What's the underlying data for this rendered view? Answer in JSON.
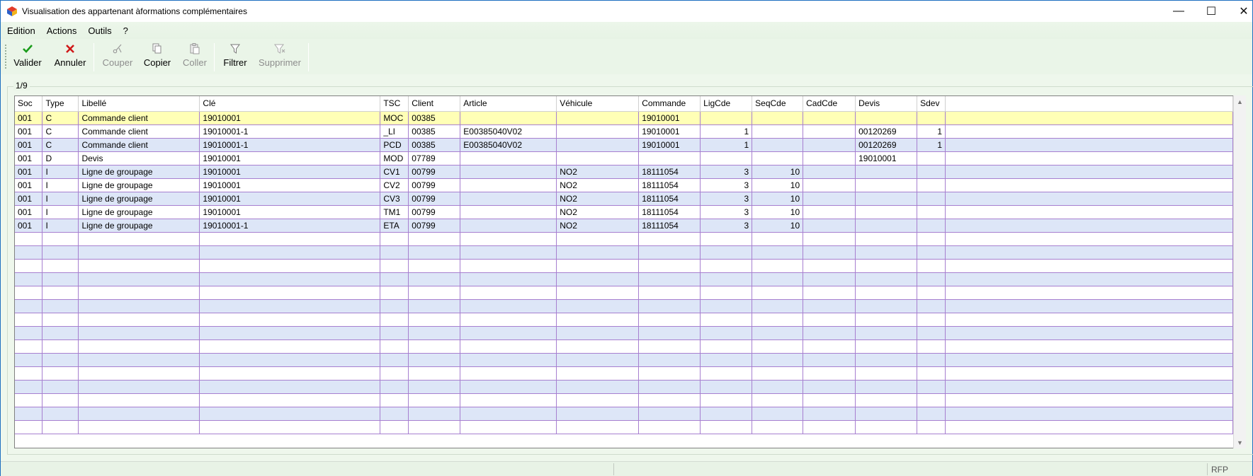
{
  "window": {
    "title": "Visualisation des appartenant àformations complémentaires",
    "minimize_glyph": "—",
    "maximize_glyph": "☐",
    "close_glyph": "✕"
  },
  "menu": [
    "Edition",
    "Actions",
    "Outils",
    "?"
  ],
  "toolbar": {
    "valider": "Valider",
    "annuler": "Annuler",
    "couper": "Couper",
    "copier": "Copier",
    "coller": "Coller",
    "filtrer": "Filtrer",
    "supprimer": "Supprimer"
  },
  "group": {
    "label": "1/9"
  },
  "grid": {
    "columns": [
      "Soc",
      "Type",
      "Libellé",
      "Clé",
      "TSC",
      "Client",
      "Article",
      "Véhicule",
      "Commande",
      "LigCde",
      "SeqCde",
      "CadCde",
      "Devis",
      "Sdev",
      ""
    ],
    "selected_row": 0,
    "rows": [
      [
        "001",
        "C",
        "Commande client",
        "19010001",
        "MOC",
        "00385",
        "",
        "",
        "19010001",
        "",
        "",
        "",
        "",
        "",
        ""
      ],
      [
        "001",
        "C",
        "Commande client",
        "19010001-1",
        "_LI",
        "00385",
        "E00385040V02",
        "",
        "19010001",
        "1",
        "",
        "",
        "00120269",
        "1",
        ""
      ],
      [
        "001",
        "C",
        "Commande client",
        "19010001-1",
        "PCD",
        "00385",
        "E00385040V02",
        "",
        "19010001",
        "1",
        "",
        "",
        "00120269",
        "1",
        ""
      ],
      [
        "001",
        "D",
        "Devis",
        "19010001",
        "MOD",
        "07789",
        "",
        "",
        "",
        "",
        "",
        "",
        "19010001",
        "",
        ""
      ],
      [
        "001",
        "I",
        "Ligne de groupage",
        "19010001",
        "CV1",
        "00799",
        "",
        "NO2",
        "18111054",
        "3",
        "10",
        "",
        "",
        "",
        ""
      ],
      [
        "001",
        "I",
        "Ligne de groupage",
        "19010001",
        "CV2",
        "00799",
        "",
        "NO2",
        "18111054",
        "3",
        "10",
        "",
        "",
        "",
        ""
      ],
      [
        "001",
        "I",
        "Ligne de groupage",
        "19010001",
        "CV3",
        "00799",
        "",
        "NO2",
        "18111054",
        "3",
        "10",
        "",
        "",
        "",
        ""
      ],
      [
        "001",
        "I",
        "Ligne de groupage",
        "19010001",
        "TM1",
        "00799",
        "",
        "NO2",
        "18111054",
        "3",
        "10",
        "",
        "",
        "",
        ""
      ],
      [
        "001",
        "I",
        "Ligne de groupage",
        "19010001-1",
        "ETA",
        "00799",
        "",
        "NO2",
        "18111054",
        "3",
        "10",
        "",
        "",
        "",
        ""
      ]
    ],
    "numeric_columns": [
      9,
      10,
      13
    ]
  },
  "statusbar": {
    "right_text": "RFP"
  },
  "colors": {
    "selected_row": "#ffffb6",
    "alt_row": "#dde6f7",
    "grid_line": "#a77fd0",
    "valider_icon": "#1a9c1a",
    "annuler_icon": "#d01818"
  }
}
